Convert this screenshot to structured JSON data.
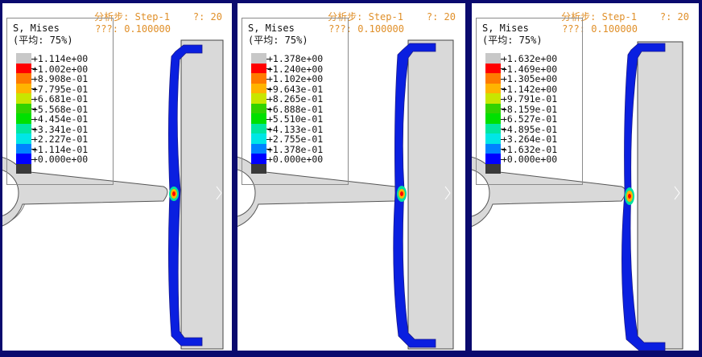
{
  "header": {
    "step_label": "分析步: Step-1",
    "increment_label": "?: 20",
    "time_label": "???: 0.100000"
  },
  "legend": {
    "title": "S, Mises",
    "subtitle": "(平均: 75%)"
  },
  "colors": {
    "scale": [
      "#c8c8c8",
      "#ff0000",
      "#ff7a00",
      "#ffb400",
      "#c8e600",
      "#32d200",
      "#00e000",
      "#00e6a0",
      "#00e6e6",
      "#0082ff",
      "#0000ff",
      "#3a3a3a"
    ],
    "base_gray": "#d9d9d9",
    "shell_blue": "#0a1fe0",
    "frame": "#0a0a6e",
    "label_orange": "#e0902a"
  },
  "panels": [
    {
      "legend_values": [
        "+1.114e+00",
        "+1.002e+00",
        "+8.908e-01",
        "+7.795e-01",
        "+6.681e-01",
        "+5.568e-01",
        "+4.454e-01",
        "+3.341e-01",
        "+2.227e-01",
        "+1.114e-01",
        "+0.000e+00"
      ]
    },
    {
      "legend_values": [
        "+1.378e+00",
        "+1.240e+00",
        "+1.102e+00",
        "+9.643e-01",
        "+8.265e-01",
        "+6.888e-01",
        "+5.510e-01",
        "+4.133e-01",
        "+2.755e-01",
        "+1.378e-01",
        "+0.000e+00"
      ]
    },
    {
      "legend_values": [
        "+1.632e+00",
        "+1.469e+00",
        "+1.305e+00",
        "+1.142e+00",
        "+9.791e-01",
        "+8.159e-01",
        "+6.527e-01",
        "+4.895e-01",
        "+3.264e-01",
        "+1.632e-01",
        "+0.000e+00"
      ]
    }
  ]
}
